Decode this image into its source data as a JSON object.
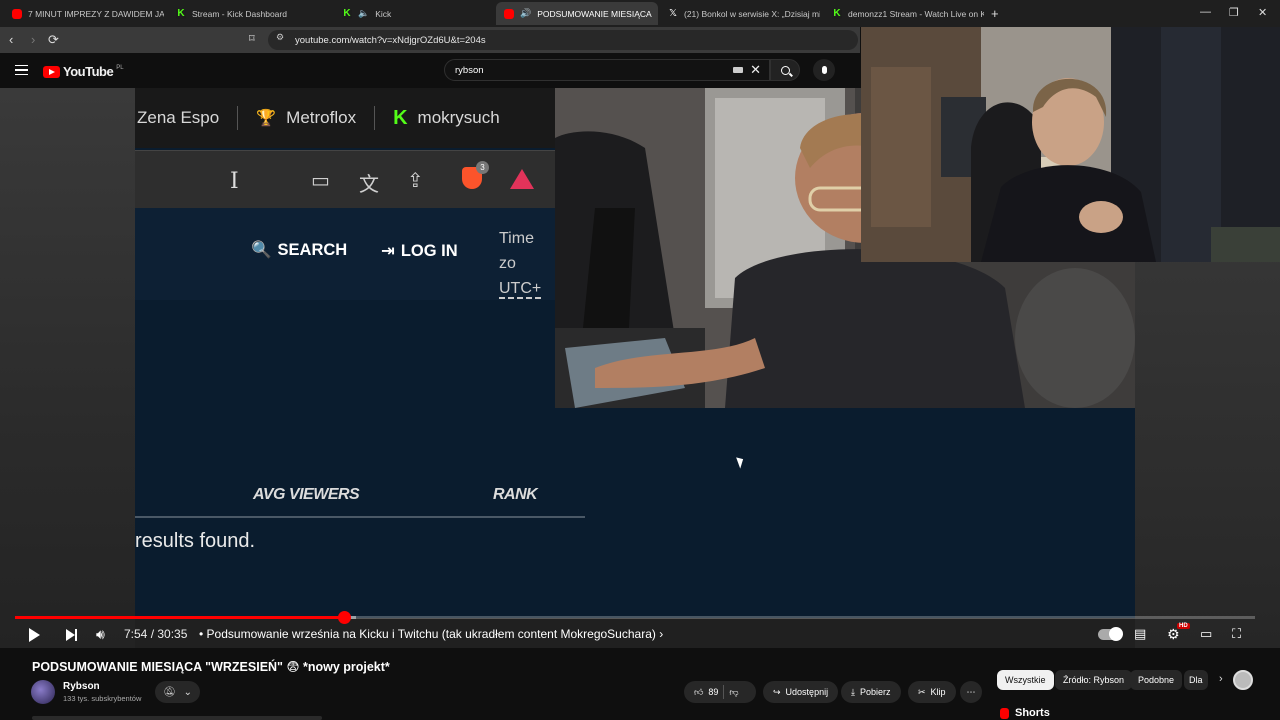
{
  "browser": {
    "tabs": [
      {
        "icon": "youtube-favicon",
        "label": "7 MINUT IMPREZY Z DAWIDEM JASP"
      },
      {
        "icon": "kick-favicon",
        "label": "Stream - Kick Dashboard"
      },
      {
        "icon": "kick-favicon",
        "label": "Kick"
      },
      {
        "icon": "youtube-favicon",
        "label": "PODSUMOWANIE MIESIĄCA",
        "active": true
      },
      {
        "icon": "x-favicon",
        "label": "(21) Bonkol w serwisie X: „Dzisiaj mia"
      },
      {
        "icon": "kick-favicon",
        "label": "demonzz1 Stream - Watch Live on Ki"
      }
    ],
    "url": "youtube.com/watch?v=xNdjgrOZd6U&t=204s"
  },
  "youtube": {
    "logo_text": "YouTube",
    "region": "PL",
    "search_query": "rybson"
  },
  "screen_content": {
    "streamers": [
      "Zena Espo",
      "Metroflox",
      "mokrysuch"
    ],
    "nav_search": "SEARCH",
    "nav_login": "LOG IN",
    "timezone_label": "Time zo",
    "timezone_value": "UTC+",
    "col_avg_viewers": "AVG VIEWERS",
    "col_rank": "RANK",
    "results_text": "results found.",
    "brave_badge": "3"
  },
  "player": {
    "progress_fraction": 0.2656,
    "buffered_fraction": 0.275,
    "time_current": "7:54",
    "time_total": "30:35",
    "chapter": "Podsumowanie września na Kicku i Twitchu (tak ukradłem content MokregoSuchara)",
    "hd_badge": "HD"
  },
  "video": {
    "title": "PODSUMOWANIE MIESIĄCA \"WRZESIEŃ\" 😨 *nowy projekt*",
    "channel": "Rybson",
    "subscribers": "133 tys. subskrybentów",
    "likes": "89",
    "share_label": "Udostępnij",
    "download_label": "Pobierz",
    "clip_label": "Klip"
  },
  "chips": [
    "Wszystkie",
    "Źródło: Rybson",
    "Podobne",
    "Dla"
  ],
  "shorts_label": "Shorts",
  "colors": {
    "accent": "#ff0000",
    "kick_green": "#53fc18"
  }
}
